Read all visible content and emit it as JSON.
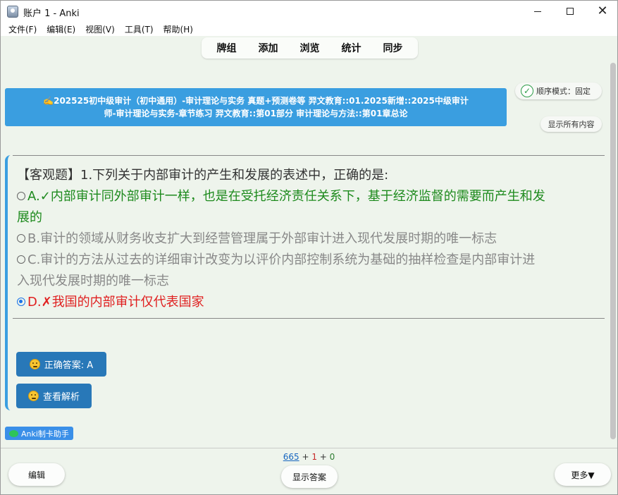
{
  "window": {
    "title": "账户 1 - Anki"
  },
  "menu": [
    "文件(F)",
    "编辑(E)",
    "视图(V)",
    "工具(T)",
    "帮助(H)"
  ],
  "toolbar": [
    "牌组",
    "添加",
    "浏览",
    "统计",
    "同步"
  ],
  "card": {
    "deck_line1": "✍️202525初中级审计（初中通用）-审计理论与实务 真题+预测卷等 羿文教育::01.2025新增::2025中级审计",
    "deck_line2": "师-审计理论与实务-章节练习 羿文教育::第01部分 审计理论与方法::第01章总论",
    "order_mode": "顺序模式：固定",
    "show_all": "显示所有内容",
    "question": "【客观题】1.下列关于内部审计的产生和发展的表述中，正确的是:",
    "options": {
      "a_prefix": "A.",
      "a_mark": "✓",
      "a_text": "内部审计同外部审计一样，也是在受托经济责任关系下，基于经济监督的需要而产生和发",
      "a_text2": "展的",
      "b": "B.审计的领域从财务收支扩大到经营管理属于外部审计进入现代发展时期的唯一标志",
      "c_line1": "C.审计的方法从过去的详细审计改变为以评价内部控制系统为基础的抽样检查是内部审计进",
      "c_line2": "入现代发展时期的唯一标志",
      "d_prefix": "D.",
      "d_mark": "✗",
      "d_text": "我国的内部审计仅代表国家"
    },
    "correct_answer": "正确答案: A",
    "view_analysis": "查看解析",
    "helper_badge": "Anki制卡助手"
  },
  "bottom": {
    "count_new": "665",
    "plus1": " + ",
    "count_learn": "1",
    "plus2": " + ",
    "count_review": "0",
    "edit": "编辑",
    "show_answer": "显示答案",
    "more": "更多▼"
  },
  "colors": {
    "accent": "#3a9ee0",
    "button_blue": "#2878b8",
    "correct_green": "#1d8a1d",
    "wrong_red": "#e02020",
    "background": "#eef4ec"
  }
}
